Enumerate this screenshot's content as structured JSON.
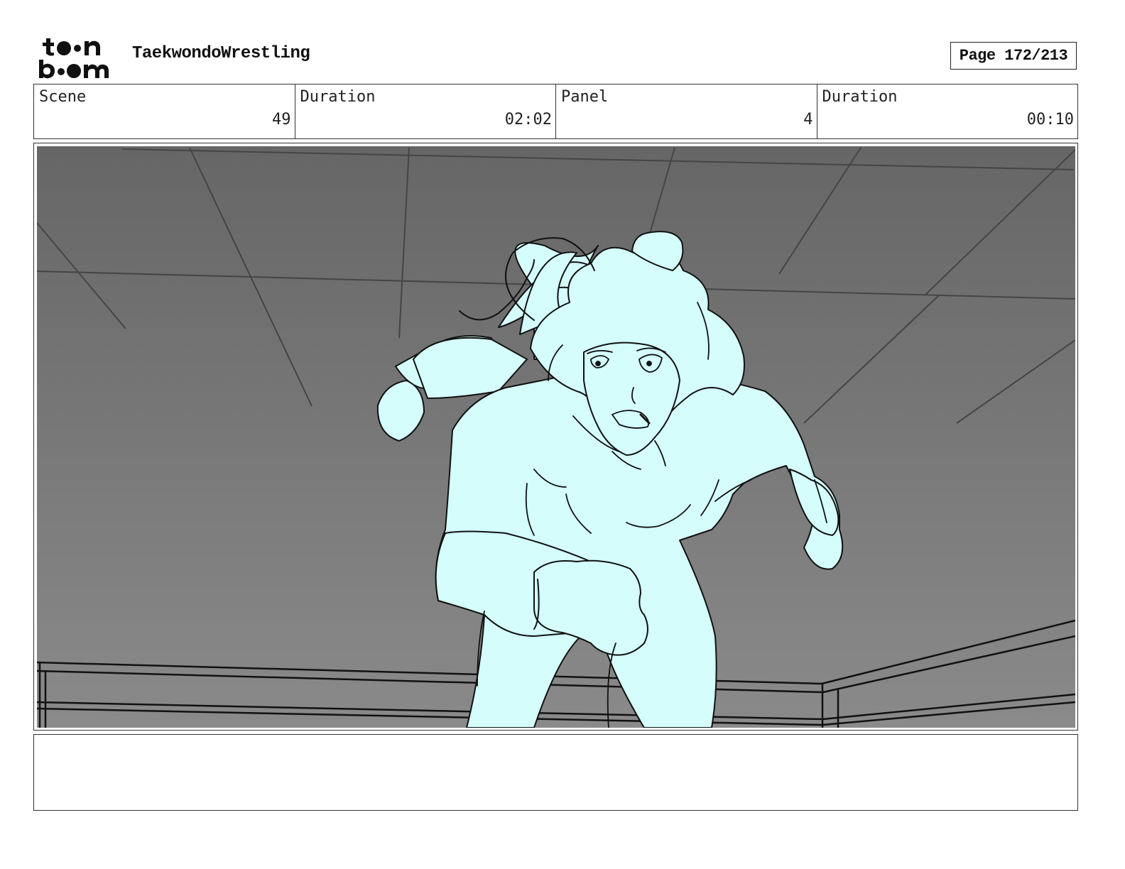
{
  "header": {
    "logo_text_top": "toon",
    "logo_text_bottom": "boom",
    "project_title": "TaekwondoWrestling",
    "page_indicator": "Page 172/213"
  },
  "info": {
    "scene_label": "Scene",
    "scene_value": "49",
    "scene_duration_label": "Duration",
    "scene_duration_value": "02:02",
    "panel_label": "Panel",
    "panel_value": "4",
    "panel_duration_label": "Duration",
    "panel_duration_value": "00:10"
  },
  "panel": {
    "background_color": "#7a7a7a",
    "character_fill": "#d4fdfb",
    "line_color": "#111111",
    "icon": "storyboard-drawing"
  },
  "notes": {
    "text": ""
  }
}
